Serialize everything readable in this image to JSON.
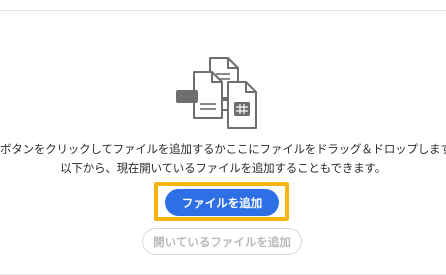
{
  "drop_area": {
    "illustration_icon": "files-drag-drop-icon",
    "message_line1": "ボタンをクリックしてファイルを追加するかここにファイルをドラッグ＆ドロップします。",
    "message_line2": "以下から、現在開いているファイルを追加することもできます。",
    "add_files_label": "ファイルを追加",
    "add_open_files_label": "開いているファイルを追加",
    "add_open_files_enabled": false
  },
  "colors": {
    "primary_button": "#2d6fe5",
    "highlight_outline": "#f6b60f",
    "disabled_text": "#b9b9b9"
  }
}
